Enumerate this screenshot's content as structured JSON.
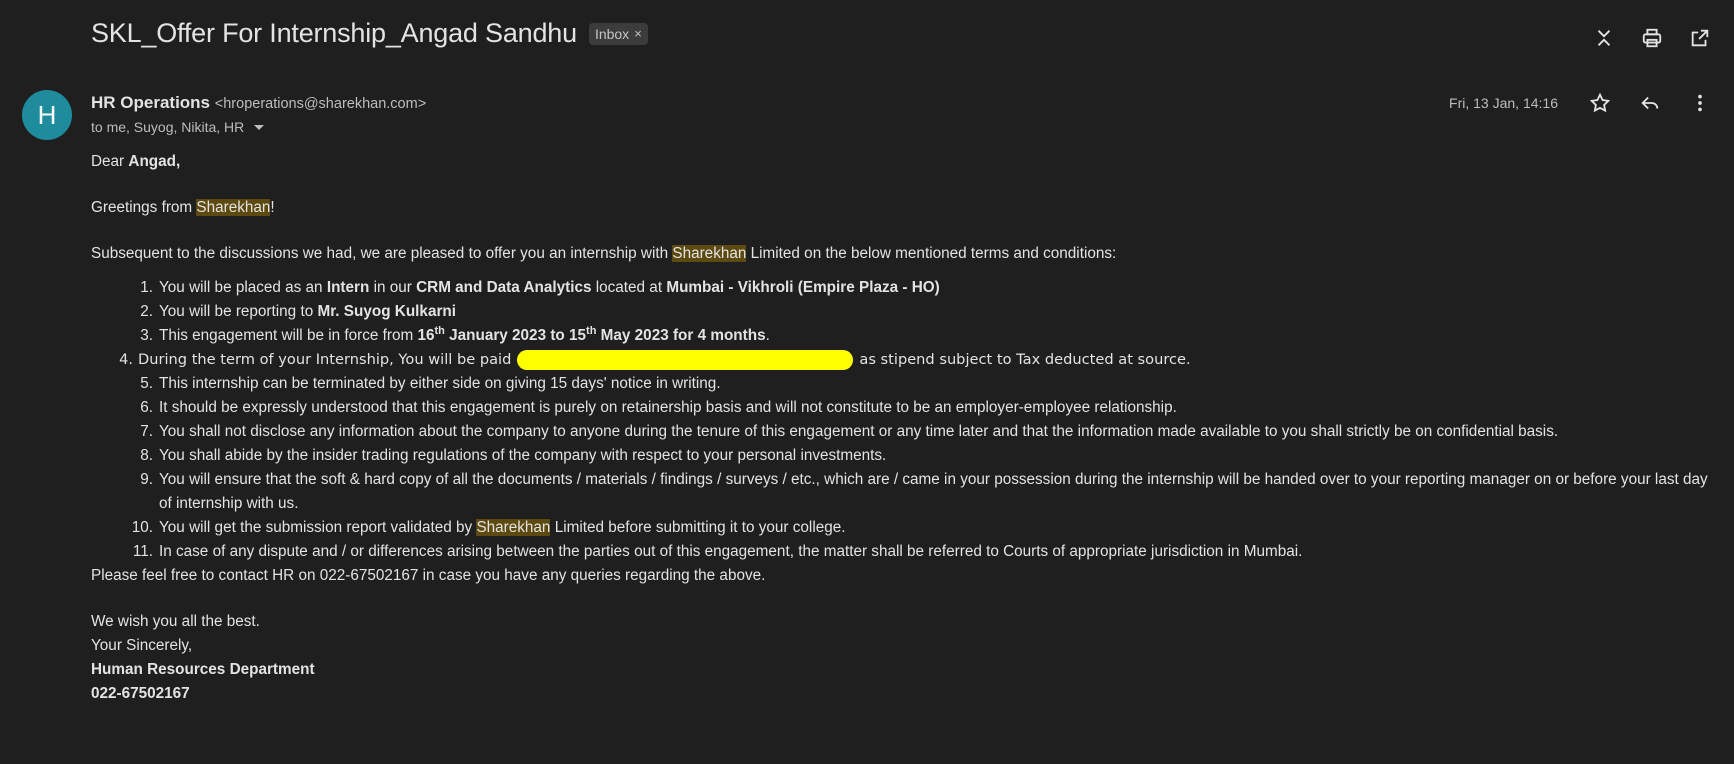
{
  "header": {
    "subject": "SKL_Offer For Internship_Angad Sandhu",
    "label": "Inbox",
    "label_close": "×"
  },
  "sender": {
    "avatar_letter": "H",
    "avatar_color": "#1e8c9c",
    "name": "HR Operations",
    "email": "<hroperations@sharekhan.com>",
    "to": "to me, Suyog, Nikita, HR",
    "date": "Fri, 13 Jan, 14:16"
  },
  "body": {
    "greeting_prefix": "Dear ",
    "greeting_name": "Angad,",
    "greetings_prefix": "Greetings from ",
    "company": "Sharekhan",
    "greetings_suffix": "!",
    "intro_prefix": "Subsequent to the discussions we had, we are pleased to offer you an internship with ",
    "intro_suffix": " Limited on the below mentioned terms and conditions:",
    "items": {
      "n1": "1.",
      "i1a": "You will be placed as an ",
      "i1b": "Intern",
      "i1c": " in our ",
      "i1d": "CRM and Data Analytics",
      "i1e": " located at ",
      "i1f": "Mumbai - Vikhroli (Empire Plaza - HO)",
      "n2": "2.",
      "i2a": "You will be reporting to ",
      "i2b": "Mr. Suyog Kulkarni",
      "n3": "3.",
      "i3a": "This engagement will be in force from ",
      "i3b": "16",
      "i3c": "th",
      "i3d": " January 2023 to 15",
      "i3e": "th",
      "i3f": " May 2023 for 4 months",
      "i3g": ".",
      "n4": "4.",
      "i4a": "During the term of your Internship, You will be paid",
      "i4b": "as stipend subject to Tax deducted at source.",
      "n5": "5.",
      "i5": "This internship can be terminated by either side on giving 15 days' notice in writing.",
      "n6": "6.",
      "i6": "It should be expressly understood that this engagement is purely on retainership basis and will not constitute to be an employer-employee relationship.",
      "n7": "7.",
      "i7": "You shall not disclose any information about the company to anyone during the tenure of this engagement or any time later and that the information made available to you shall strictly be on confidential basis.",
      "n8": "8.",
      "i8": "You shall abide by the insider trading regulations of the company with respect to your personal investments.",
      "n9": "9.",
      "i9": "You will ensure that the soft & hard copy of all the documents / materials / findings / surveys / etc., which are / came in your possession during the internship will be handed over to your reporting manager on or before your last day of internship with us.",
      "n10": "10.",
      "i10a": "You will get the submission report validated by ",
      "i10b": " Limited before submitting it to your college.",
      "n11": "11.",
      "i11": "In case of any dispute and / or differences arising between the parties out of this engagement, the matter shall be referred to Courts of appropriate jurisdiction in Mumbai."
    },
    "contact": "Please feel free to contact HR on 022-67502167 in case you have any queries regarding the above.",
    "wish": "We wish you all the best.",
    "closing": "Your Sincerely,",
    "dept": "Human Resources Department",
    "phone": "022-67502167"
  },
  "icons": [
    "expand-collapse-icon",
    "print-icon",
    "open-new-window-icon",
    "star-icon",
    "reply-icon",
    "more-vert-icon"
  ]
}
